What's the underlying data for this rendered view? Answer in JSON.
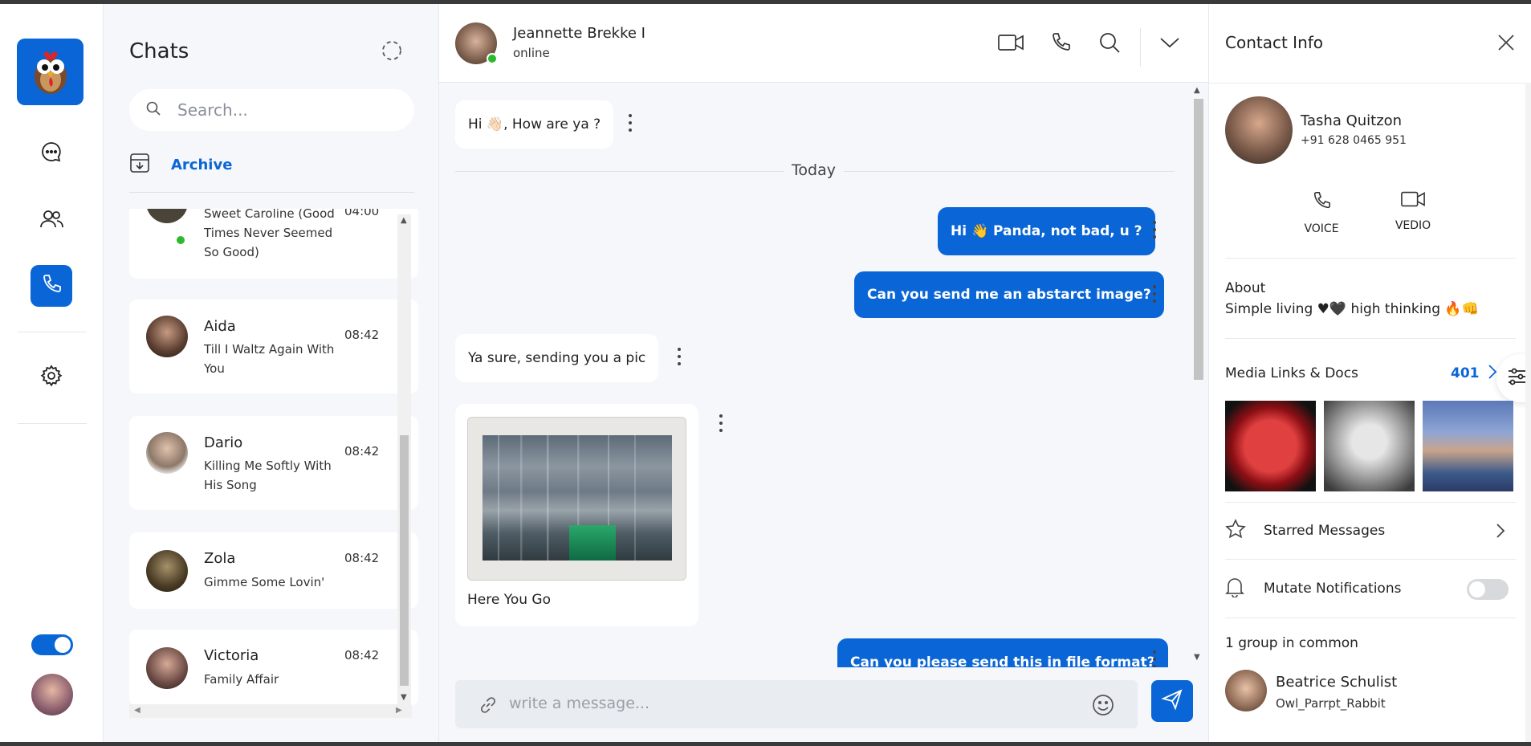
{
  "rail": {
    "nav": [
      "chat-icon",
      "users-icon",
      "phone-icon",
      "settings-icon"
    ],
    "active": "phone-icon",
    "dark_mode_toggle": "on"
  },
  "chats": {
    "title": "Chats",
    "search_placeholder": "Search...",
    "archive_label": "Archive",
    "items": [
      {
        "name": "",
        "message": "Sweet Caroline (Good Times Never Seemed So Good)",
        "time": "04:00",
        "online": true
      },
      {
        "name": "Aida",
        "message": "Till I Waltz Again With You",
        "time": "08:42"
      },
      {
        "name": "Dario",
        "message": "Killing Me Softly With His Song",
        "time": "08:42"
      },
      {
        "name": "Zola",
        "message": "Gimme Some Lovin'",
        "time": "08:42"
      },
      {
        "name": "Victoria",
        "message": "Family Affair",
        "time": "08:42"
      }
    ]
  },
  "conversation": {
    "contact_name": "Jeannette Brekke I",
    "status": "online",
    "day_label": "Today",
    "messages": [
      {
        "dir": "in",
        "text": "Hi 👋🏻, How are ya ?"
      },
      {
        "dir": "out",
        "text": "Hi 👋 Panda, not bad, u ?"
      },
      {
        "dir": "out",
        "text": "Can you send me an abstarct image?"
      },
      {
        "dir": "in",
        "text": "Ya sure, sending you a pic"
      },
      {
        "dir": "in",
        "text": "Here You Go",
        "type": "image"
      },
      {
        "dir": "out",
        "text": "Can you please send this in file format?"
      }
    ],
    "composer_placeholder": "write a message..."
  },
  "contact_info": {
    "title": "Contact Info",
    "name": "Tasha Quitzon",
    "phone": "+91 628 0465 951",
    "voice_label": "VOICE",
    "video_label": "VEDIO",
    "about_heading": "About",
    "about_text": "Simple living ♥🖤 high thinking 🔥👊",
    "media_heading": "Media Links & Docs",
    "media_count": "401",
    "starred_label": "Starred Messages",
    "mute_label": "Mutate Notifications",
    "mute_state": "off",
    "groups_heading": "1 group in common",
    "group_name": "Beatrice Schulist",
    "group_sub": "Owl_Parrpt_Rabbit"
  },
  "colors": {
    "accent": "#0a66d6",
    "panel_bg": "#f5f7fb",
    "online": "#2db82d"
  }
}
